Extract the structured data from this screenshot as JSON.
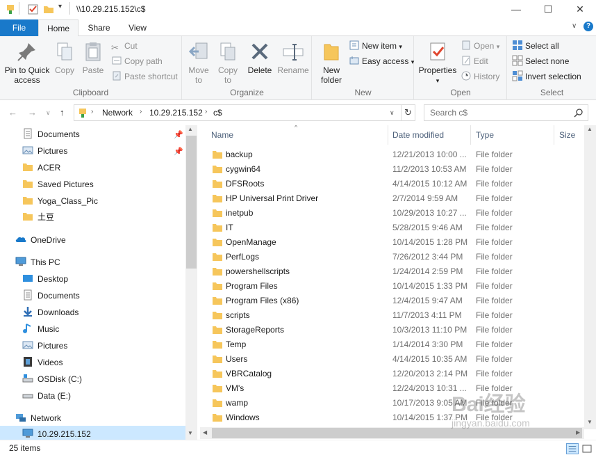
{
  "window": {
    "title": "\\\\10.29.215.152\\c$",
    "minimize_glyph": "—",
    "maximize_glyph": "☐",
    "close_glyph": "✕"
  },
  "ribbon_tabs": [
    "File",
    "Home",
    "Share",
    "View"
  ],
  "ribbon": {
    "clipboard": {
      "label": "Clipboard",
      "pin": "Pin to Quick access",
      "copy": "Copy",
      "paste": "Paste",
      "cut": "Cut",
      "copy_path": "Copy path",
      "paste_shortcut": "Paste shortcut"
    },
    "organize": {
      "label": "Organize",
      "move_to": "Move to",
      "copy_to": "Copy to",
      "delete": "Delete",
      "rename": "Rename"
    },
    "new": {
      "label": "New",
      "new_folder": "New folder",
      "new_item": "New item",
      "easy_access": "Easy access"
    },
    "open": {
      "label": "Open",
      "properties": "Properties",
      "open": "Open",
      "edit": "Edit",
      "history": "History"
    },
    "select": {
      "label": "Select",
      "select_all": "Select all",
      "select_none": "Select none",
      "invert": "Invert selection"
    }
  },
  "address": {
    "crumbs": [
      "Network",
      "10.29.215.152",
      "c$"
    ],
    "search_placeholder": "Search c$"
  },
  "nav_pane": {
    "quick_access": [
      "Documents",
      "Pictures",
      "ACER",
      "Saved Pictures",
      "Yoga_Class_Pic",
      "土豆"
    ],
    "onedrive": "OneDrive",
    "this_pc": "This PC",
    "this_pc_items": [
      "Desktop",
      "Documents",
      "Downloads",
      "Music",
      "Pictures",
      "Videos",
      "OSDisk (C:)",
      "Data (E:)"
    ],
    "network": "Network",
    "network_items": [
      "10.29.215.152"
    ]
  },
  "columns": [
    "Name",
    "Date modified",
    "Type",
    "Size"
  ],
  "files": [
    {
      "name": "backup",
      "date": "12/21/2013 10:00 ...",
      "type": "File folder"
    },
    {
      "name": "cygwin64",
      "date": "11/2/2013 10:53 AM",
      "type": "File folder"
    },
    {
      "name": "DFSRoots",
      "date": "4/14/2015 10:12 AM",
      "type": "File folder"
    },
    {
      "name": "HP Universal Print Driver",
      "date": "2/7/2014 9:59 AM",
      "type": "File folder"
    },
    {
      "name": "inetpub",
      "date": "10/29/2013 10:27 ...",
      "type": "File folder"
    },
    {
      "name": "IT",
      "date": "5/28/2015 9:46 AM",
      "type": "File folder"
    },
    {
      "name": "OpenManage",
      "date": "10/14/2015 1:28 PM",
      "type": "File folder"
    },
    {
      "name": "PerfLogs",
      "date": "7/26/2012 3:44 PM",
      "type": "File folder"
    },
    {
      "name": "powershellscripts",
      "date": "1/24/2014 2:59 PM",
      "type": "File folder"
    },
    {
      "name": "Program Files",
      "date": "10/14/2015 1:33 PM",
      "type": "File folder"
    },
    {
      "name": "Program Files (x86)",
      "date": "12/4/2015 9:47 AM",
      "type": "File folder"
    },
    {
      "name": "scripts",
      "date": "11/7/2013 4:11 PM",
      "type": "File folder"
    },
    {
      "name": "StorageReports",
      "date": "10/3/2013 11:10 PM",
      "type": "File folder"
    },
    {
      "name": "Temp",
      "date": "1/14/2014 3:30 PM",
      "type": "File folder"
    },
    {
      "name": "Users",
      "date": "4/14/2015 10:35 AM",
      "type": "File folder"
    },
    {
      "name": "VBRCatalog",
      "date": "12/20/2013 2:14 PM",
      "type": "File folder"
    },
    {
      "name": "VM's",
      "date": "12/24/2013 10:31 ...",
      "type": "File folder"
    },
    {
      "name": "wamp",
      "date": "10/17/2013 9:05 AM",
      "type": "File folder"
    },
    {
      "name": "Windows",
      "date": "10/14/2015 1:37 PM",
      "type": "File folder"
    }
  ],
  "status": {
    "item_count": "25 items"
  },
  "watermark": {
    "text": "Bai经验",
    "url": "jingyan.baidu.com"
  },
  "colors": {
    "accent": "#1979ca",
    "folder": "#f6c65b",
    "selected": "#cce8ff"
  }
}
